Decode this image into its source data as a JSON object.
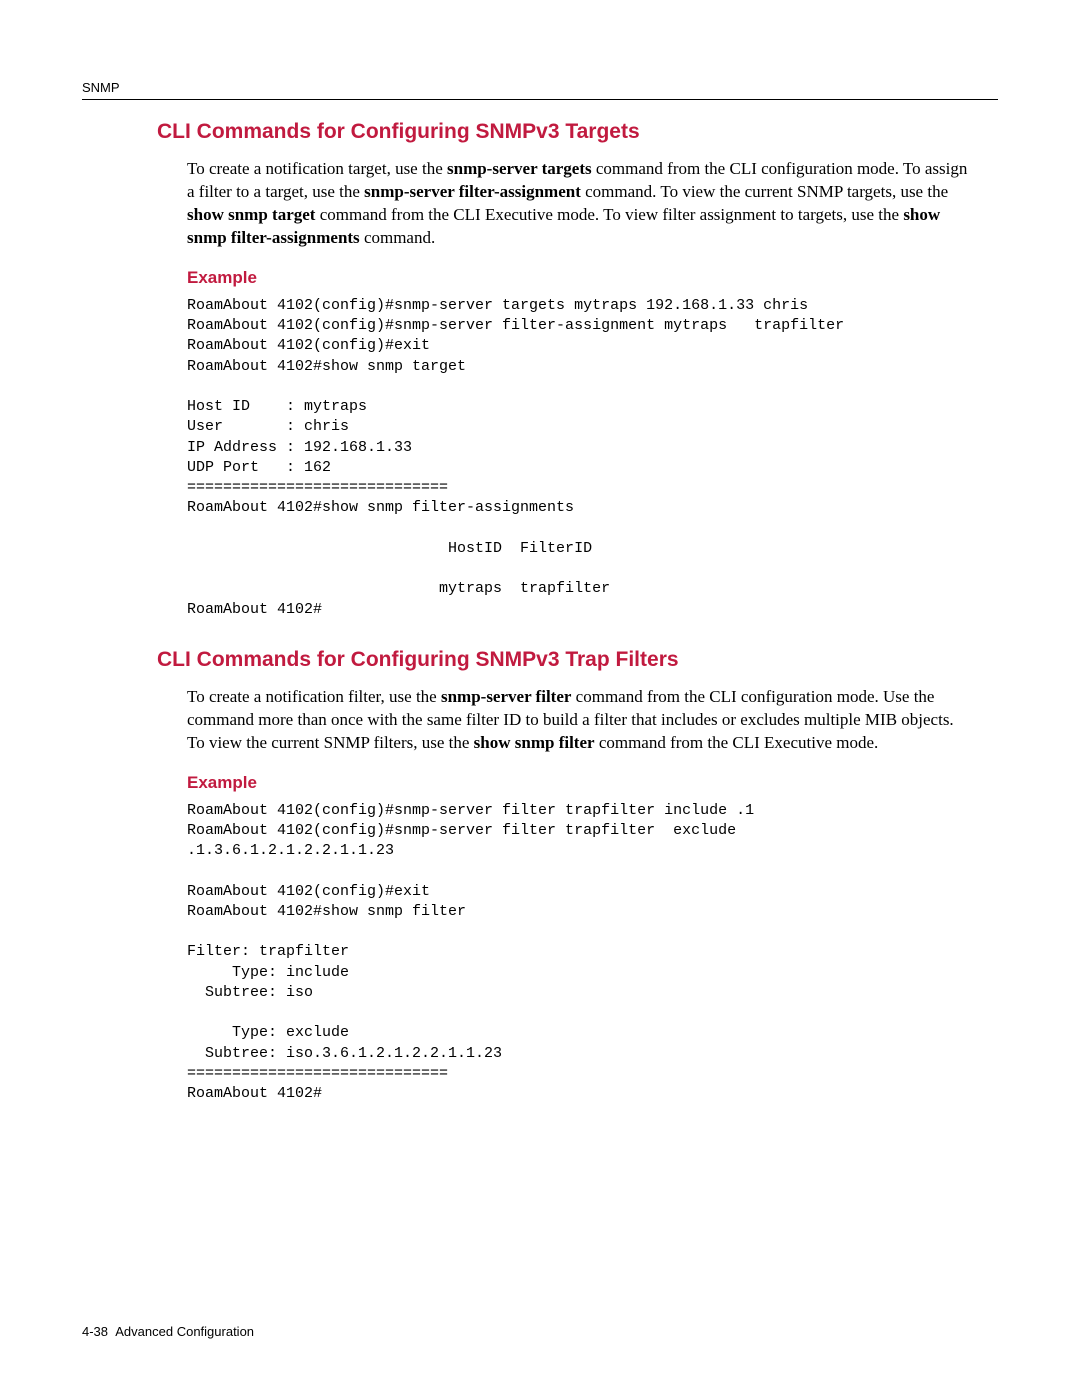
{
  "header": {
    "running_head": "SNMP"
  },
  "sec1": {
    "title": "CLI Commands for Configuring SNMPv3 Targets",
    "p_a": "To create a notification target, use the ",
    "p_b": "snmp-server targets",
    "p_c": " command from the CLI configuration mode. To assign a filter to a target, use the ",
    "p_d": "snmp-server filter-assignment",
    "p_e": " command. To view the current SNMP targets, use the ",
    "p_f": "show snmp target",
    "p_g": " command from the CLI Executive mode. To view filter assignment to targets, use the ",
    "p_h": "show snmp filter-assignments",
    "p_i": " command.",
    "example_label": "Example",
    "code": "RoamAbout 4102(config)#snmp-server targets mytraps 192.168.1.33 chris\nRoamAbout 4102(config)#snmp-server filter-assignment mytraps   trapfilter\nRoamAbout 4102(config)#exit\nRoamAbout 4102#show snmp target\n\nHost ID    : mytraps\nUser       : chris\nIP Address : 192.168.1.33\nUDP Port   : 162\n=============================\nRoamAbout 4102#show snmp filter-assignments\n\n                             HostID  FilterID\n\n                            mytraps  trapfilter\nRoamAbout 4102#"
  },
  "sec2": {
    "title": "CLI Commands for Configuring SNMPv3 Trap Filters",
    "p_a": "To create a notification filter, use the ",
    "p_b": "snmp-server filter",
    "p_c": " command from the CLI configuration mode. Use the command more than once with the same filter ID to build a filter that includes or excludes multiple MIB objects. To view the current SNMP filters, use the ",
    "p_d": "show snmp filter",
    "p_e": " command from the CLI Executive mode.",
    "example_label": "Example",
    "code": "RoamAbout 4102(config)#snmp-server filter trapfilter include .1\nRoamAbout 4102(config)#snmp-server filter trapfilter  exclude\n.1.3.6.1.2.1.2.2.1.1.23\n\nRoamAbout 4102(config)#exit\nRoamAbout 4102#show snmp filter\n\nFilter: trapfilter\n     Type: include\n  Subtree: iso\n\n     Type: exclude\n  Subtree: iso.3.6.1.2.1.2.2.1.1.23\n=============================\nRoamAbout 4102#"
  },
  "footer": {
    "page_num": "4-38",
    "label": "Advanced Configuration"
  }
}
